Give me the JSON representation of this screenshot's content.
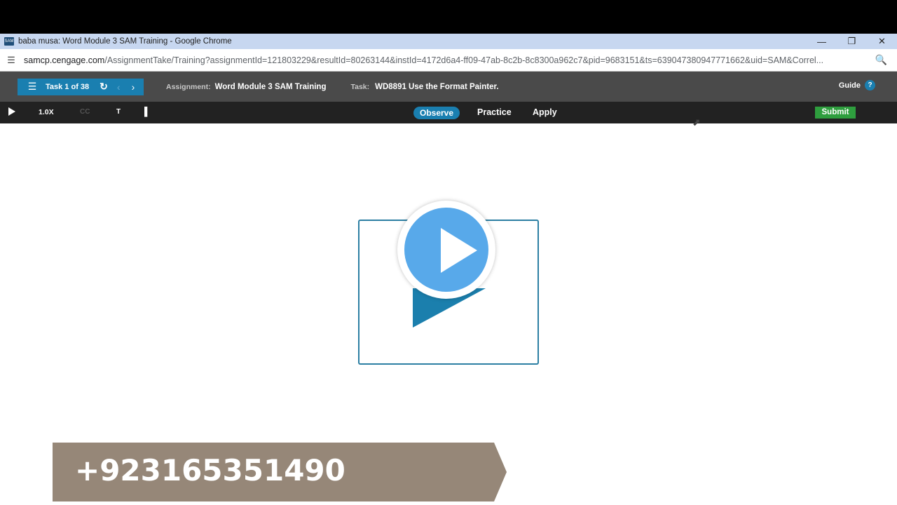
{
  "window": {
    "title": "baba musa: Word Module 3 SAM Training - Google Chrome",
    "app_icon_text": "SAM",
    "controls": [
      "minimize-icon",
      "restore-icon",
      "close-icon"
    ]
  },
  "address": {
    "host": "samcp.cengage.com",
    "path": "/AssignmentTake/Training?assignmentId=121803229&resultId=80263144&instId=4172d6a4-ff09-47ab-8c2b-8c8300a962c7&pid=9683151&ts=639047380947771662&uid=SAM&Correl..."
  },
  "header": {
    "task_label": "Task 1 of 38",
    "assignment_label": "Assignment:",
    "assignment_value": "Word Module 3 SAM Training",
    "task_field_label": "Task:",
    "task_value": "WD8891 Use the Format Painter.",
    "guide_label": "Guide",
    "guide_icon": "?"
  },
  "controls": {
    "speed": "1.0X",
    "cc": "CC",
    "text_toggle": "T",
    "modes": {
      "observe": "Observe",
      "practice": "Practice",
      "apply": "Apply"
    },
    "submit": "Submit"
  },
  "overlay": {
    "phone": "+923165351490"
  },
  "colors": {
    "accent_blue": "#1a7fb0",
    "submit_green": "#2e9e3e",
    "play_blue": "#58a9ea",
    "banner": "#968778"
  }
}
